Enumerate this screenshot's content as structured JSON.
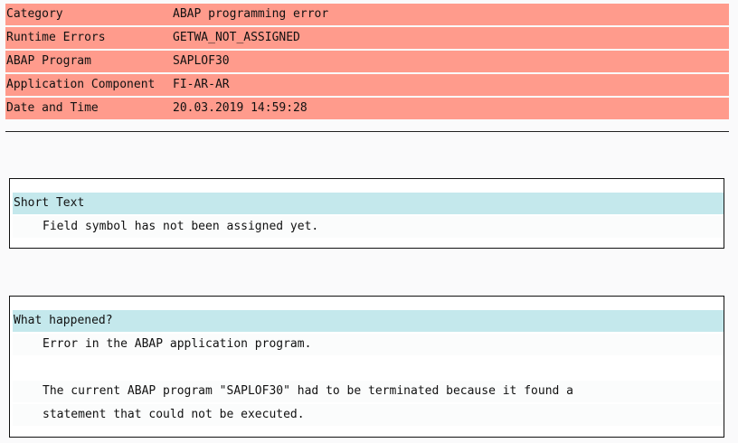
{
  "header": {
    "rows": [
      {
        "key": "Category",
        "value": "ABAP programming error"
      },
      {
        "key": "Runtime Errors",
        "value": "GETWA_NOT_ASSIGNED"
      },
      {
        "key": "ABAP Program",
        "value": "SAPLOF30"
      },
      {
        "key": "Application Component",
        "value": "FI-AR-AR"
      },
      {
        "key": "Date and Time",
        "value": "20.03.2019 14:59:28"
      }
    ]
  },
  "short_text": {
    "title": "Short Text",
    "lines": [
      "Field symbol has not been assigned yet."
    ]
  },
  "what_happened": {
    "title": "What happened?",
    "lines": [
      "Error in the ABAP application program.",
      "",
      "The current ABAP program \"SAPLOF30\" had to be terminated because it found a",
      "statement that could not be executed."
    ]
  },
  "colors": {
    "header_bg": "#ff9b8c",
    "section_title_bg": "#c4e8ec",
    "page_bg": "#fafafb"
  }
}
